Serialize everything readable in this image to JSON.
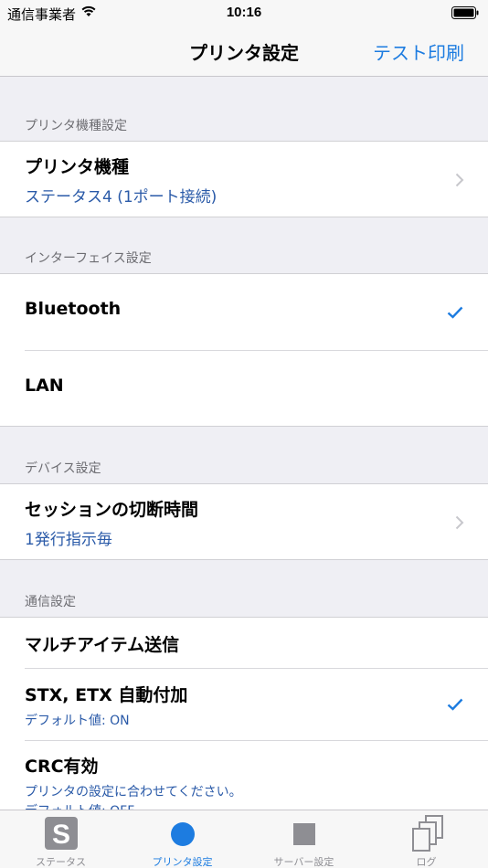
{
  "status_bar": {
    "carrier": "通信事業者",
    "time": "10:16"
  },
  "nav": {
    "title": "プリンタ設定",
    "action": "テスト印刷"
  },
  "sections": {
    "printer_model": {
      "header": "プリンタ機種設定",
      "title": "プリンタ機種",
      "value": "ステータス4 (1ポート接続)"
    },
    "interface": {
      "header": "インターフェイス設定",
      "options": [
        {
          "label": "Bluetooth",
          "selected": true
        },
        {
          "label": "LAN",
          "selected": false
        }
      ]
    },
    "device": {
      "header": "デバイス設定",
      "title": "セッションの切断時間",
      "value": "1発行指示毎"
    },
    "comm": {
      "header": "通信設定",
      "multi_item": "マルチアイテム送信",
      "stx_etx": {
        "title": "STX, ETX 自動付加",
        "sub": "デフォルト値: ON",
        "checked": true
      },
      "crc": {
        "title": "CRC有効",
        "sub1": "プリンタの設定に合わせてください。",
        "sub2": "デフォルト値: OFF"
      }
    }
  },
  "tabs": [
    {
      "label": "ステータス",
      "icon": "status-s-icon",
      "active": false
    },
    {
      "label": "プリンタ設定",
      "icon": "circle-icon",
      "active": true
    },
    {
      "label": "サーバー設定",
      "icon": "square-icon",
      "active": false
    },
    {
      "label": "ログ",
      "icon": "pages-icon",
      "active": false
    }
  ],
  "colors": {
    "accent": "#1d7ce0",
    "value_text": "#2a5aa8",
    "background": "#efeff4"
  }
}
